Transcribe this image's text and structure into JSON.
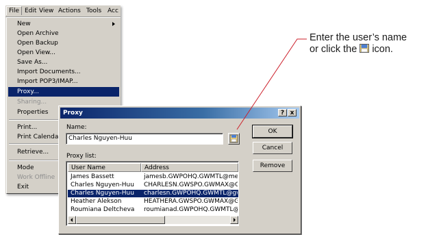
{
  "menubar": {
    "items": [
      "File",
      "Edit",
      "View",
      "Actions",
      "Tools",
      "Acc"
    ]
  },
  "file_menu": {
    "items": [
      {
        "label": "New",
        "submenu": true
      },
      {
        "label": "Open Archive"
      },
      {
        "label": "Open Backup"
      },
      {
        "label": "Open View..."
      },
      {
        "label": "Save As..."
      },
      {
        "label": "Import Documents..."
      },
      {
        "label": "Import POP3/IMAP..."
      },
      {
        "label": "Proxy...",
        "highlighted": true
      },
      {
        "label": "Sharing...",
        "disabled": true
      },
      {
        "label": "Properties"
      },
      {
        "label": "Print..."
      },
      {
        "label": "Print Calendar"
      },
      {
        "label": "Retrieve..."
      },
      {
        "label": "Mode"
      },
      {
        "label": "Work Offline",
        "disabled": true
      },
      {
        "label": "Exit"
      }
    ]
  },
  "dialog": {
    "title": "Proxy",
    "help_label": "?",
    "close_label": "x",
    "name_label": "Name:",
    "name_value": "Charles Nguyen-Huu",
    "ok_label": "OK",
    "cancel_label": "Cancel",
    "remove_label": "Remove",
    "list_label": "Proxy list:",
    "columns": [
      "User Name",
      "Address"
    ],
    "rows": [
      {
        "user": "James Bassett",
        "address": "jamesb.GWPOHQ.GWMTL@mess"
      },
      {
        "user": "Charles Nguyen-Huu",
        "address": "CHARLESN.GWSPO.GWMAX@GR"
      },
      {
        "user": "Charles Nguyen-Huu",
        "address": "charlesn.GWPOHQ.GWMTL@gwt",
        "selected": true
      },
      {
        "user": "Heather Alekson",
        "address": "HEATHERA.GWSPO.GWMAX@GR"
      },
      {
        "user": "Roumiana Deltcheva",
        "address": "roumianad.GWPOHQ.GWMTL@gu"
      }
    ]
  },
  "callout": {
    "line1": "Enter the user’s name",
    "line2_before": "or click the",
    "line2_after": "icon.",
    "icon": "address-book-icon"
  },
  "colors": {
    "highlight": "#0a246a",
    "face": "#d4d0c8",
    "callout_line": "#cc1f2a"
  }
}
